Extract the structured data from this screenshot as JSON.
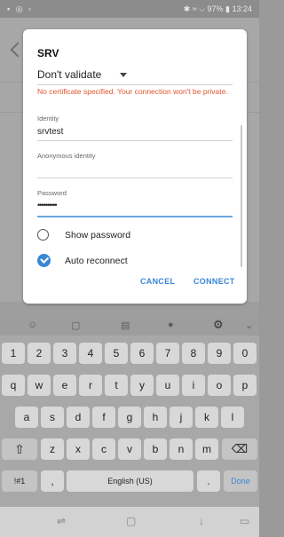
{
  "status": {
    "left_icons": "▪ ◎ ▫",
    "right_text": "✱ ≈ ⌵ 97% ▮ 13:24"
  },
  "dialog": {
    "title": "SRV",
    "dropdown_value": "Don't validate",
    "warning": "No certificate specified. Your connection won't be private.",
    "identity_label": "Identity",
    "identity_value": "srvtest",
    "anonymous_label": "Anonymous identity",
    "anonymous_value": "",
    "password_label": "Password",
    "password_value": "••••••••••",
    "show_password": "Show password",
    "auto_reconnect": "Auto reconnect",
    "cancel": "CANCEL",
    "connect": "CONNECT"
  },
  "keyboard": {
    "toolbar_icons": [
      "emoji-icon",
      "sticker-icon",
      "clipboard-icon",
      "mic-icon",
      "settings-icon",
      "collapse-icon"
    ],
    "row1": [
      "1",
      "2",
      "3",
      "4",
      "5",
      "6",
      "7",
      "8",
      "9",
      "0"
    ],
    "row2": [
      "q",
      "w",
      "e",
      "r",
      "t",
      "y",
      "u",
      "i",
      "o",
      "p"
    ],
    "row3": [
      "a",
      "s",
      "d",
      "f",
      "g",
      "h",
      "j",
      "k",
      "l"
    ],
    "row4": [
      "z",
      "x",
      "c",
      "v",
      "b",
      "n",
      "m"
    ],
    "symbols": "!#1",
    "comma": ",",
    "space_label": "English (US)",
    "period": ".",
    "done": "Done"
  }
}
